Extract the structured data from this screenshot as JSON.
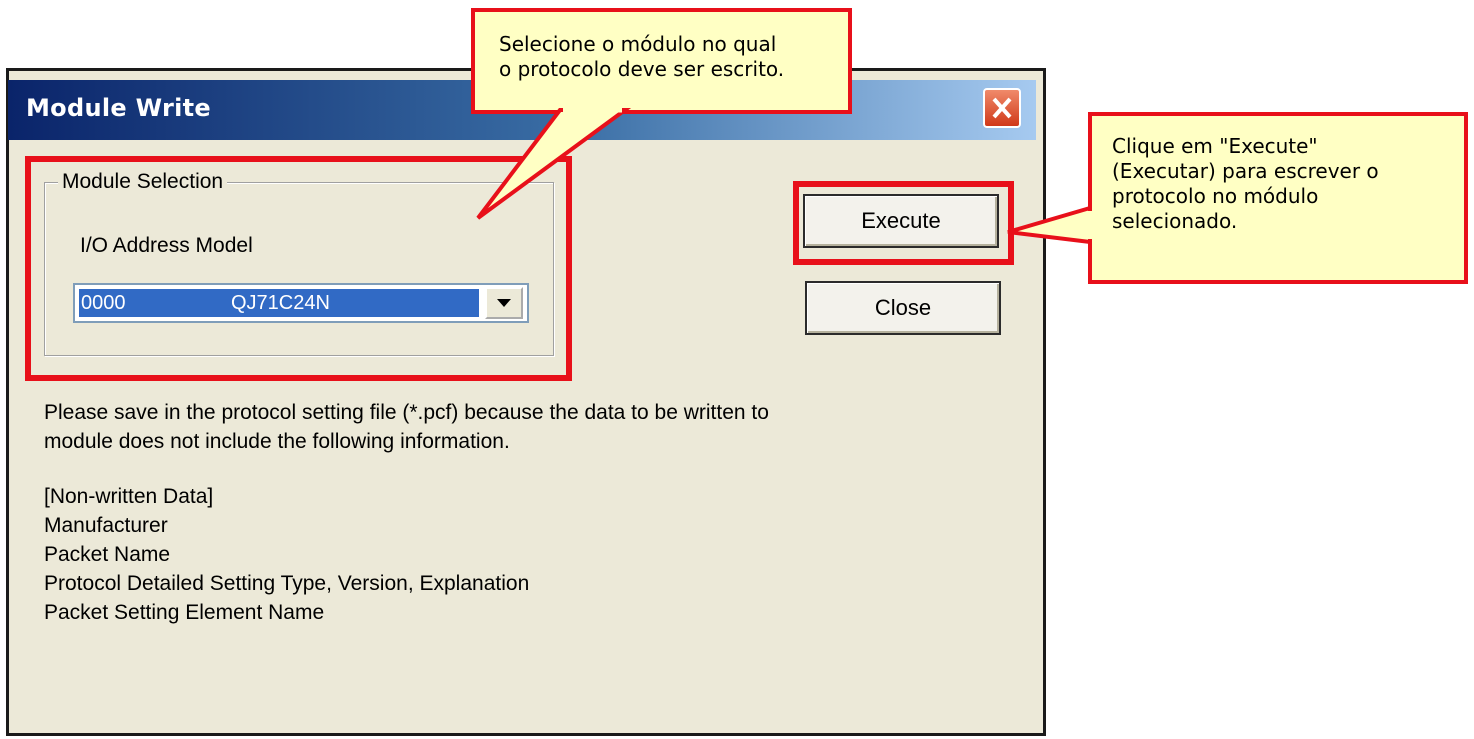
{
  "window": {
    "title": "Module Write",
    "close_icon": "close-icon"
  },
  "module_selection": {
    "group_label": "Module Selection",
    "field_label": "I/O Address Model",
    "selected_address": "0000",
    "selected_model": "QJ71C24N",
    "dropdown_icon": "chevron-down-icon"
  },
  "buttons": {
    "execute": "Execute",
    "close": "Close"
  },
  "message": {
    "line1": "Please save in the protocol setting file (*.pcf) because the data to be written to",
    "line2": "module does not include the following information.",
    "header": "[Non-written Data]",
    "items": [
      "Manufacturer",
      "Packet Name",
      "Protocol Detailed Setting Type, Version, Explanation",
      "Packet Setting Element Name"
    ]
  },
  "callouts": {
    "module": {
      "line1": "Selecione o módulo no qual",
      "line2": "o protocolo deve ser escrito."
    },
    "execute": {
      "line1": "Clique em \"Execute\"",
      "line2": "(Executar) para escrever o",
      "line3": "protocolo no módulo",
      "line4": "selecionado."
    }
  },
  "colors": {
    "highlight": "#e8101a",
    "callout_fill": "#ffffc4",
    "titlebar": "#0a246a",
    "dialog_bg": "#ece9d8"
  }
}
